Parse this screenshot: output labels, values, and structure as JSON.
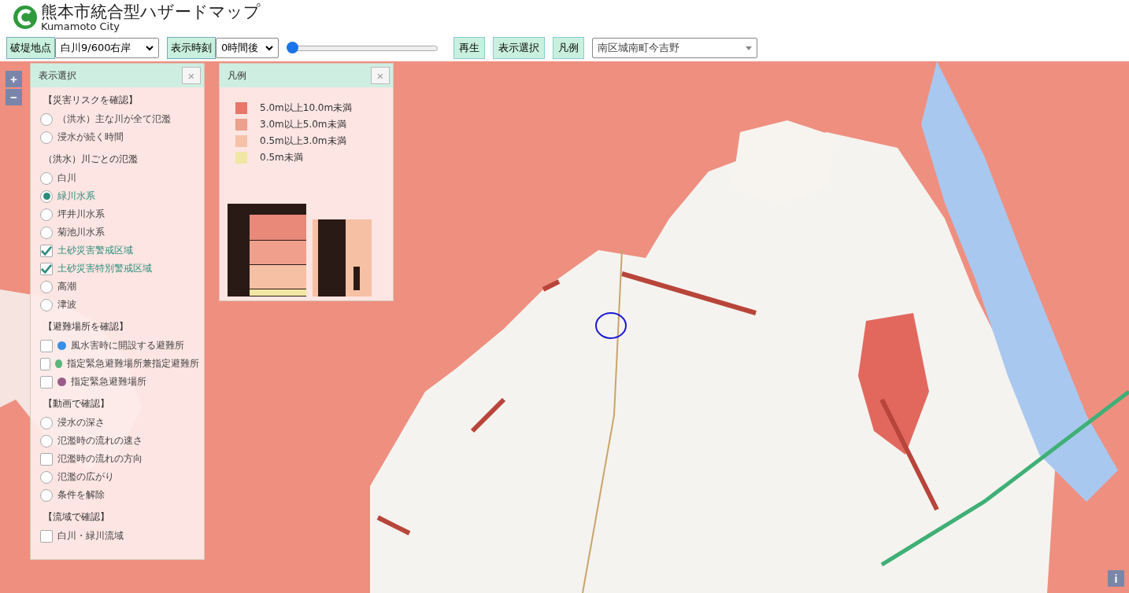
{
  "header": {
    "title": "熊本市統合型ハザードマップ",
    "subtitle": "Kumamoto City"
  },
  "toolbar": {
    "breach_label": "破堤地点",
    "breach_select": "白川9/600右岸",
    "time_label": "表示時刻",
    "time_select": "0時間後",
    "time_slider": {
      "level": 0
    },
    "buttons": [
      "再生",
      "表示選択",
      "凡例"
    ],
    "area_select": "南区城南町今吉野"
  },
  "map": {
    "zoom_in": "+",
    "zoom_out": "−",
    "info": "i"
  },
  "display_panel": {
    "title": "表示選択",
    "close": "×",
    "sections": [
      {
        "heading": "【災害リスクを確認】",
        "items": [
          {
            "kind": "radio",
            "label": "（洪水）主な川が全て氾濫",
            "selected": false
          },
          {
            "kind": "radio",
            "label": "浸水が続く時間",
            "selected": false
          }
        ]
      },
      {
        "heading": "（洪水）川ごとの氾濫",
        "items": [
          {
            "kind": "radio",
            "label": "白川",
            "selected": false
          },
          {
            "kind": "radio",
            "label": "緑川水系",
            "selected": true
          },
          {
            "kind": "radio",
            "label": "坪井川水系",
            "selected": false
          },
          {
            "kind": "radio",
            "label": "菊池川水系",
            "selected": false
          },
          {
            "kind": "checkbox",
            "label": "土砂災害警戒区域",
            "checked": true
          },
          {
            "kind": "checkbox",
            "label": "土砂災害特別警戒区域",
            "checked": true
          },
          {
            "kind": "radio",
            "label": "高潮",
            "selected": false
          },
          {
            "kind": "radio",
            "label": "津波",
            "selected": false
          }
        ]
      },
      {
        "heading": "【避難場所を確認】",
        "items": [
          {
            "kind": "checkbox",
            "label": "風水害時に開設する避難所",
            "checked": false,
            "color": "#3a8ee6"
          },
          {
            "kind": "checkbox",
            "label": "指定緊急避難場所兼指定避難所",
            "checked": false,
            "color": "#5cb57c"
          },
          {
            "kind": "checkbox",
            "label": "指定緊急避難場所",
            "checked": false,
            "color": "#9b5a88"
          }
        ]
      },
      {
        "heading": "【動画で確認】",
        "items": [
          {
            "kind": "radio",
            "label": "浸水の深さ",
            "selected": false
          },
          {
            "kind": "radio",
            "label": "氾濫時の流れの速さ",
            "selected": false
          },
          {
            "kind": "checkbox",
            "label": "氾濫時の流れの方向",
            "checked": false
          },
          {
            "kind": "radio",
            "label": "氾濫の広がり",
            "selected": false
          },
          {
            "kind": "radio",
            "label": "条件を解除",
            "selected": false
          }
        ]
      },
      {
        "heading": "【流域で確認】",
        "items": [
          {
            "kind": "checkbox",
            "label": "白川・緑川流域",
            "checked": false
          }
        ]
      }
    ]
  },
  "legend_panel": {
    "title": "凡例",
    "close": "×",
    "entries": [
      {
        "label": "5.0m以上10.0m未満",
        "color": "#e8776a"
      },
      {
        "label": "3.0m以上5.0m未満",
        "color": "#eda08c"
      },
      {
        "label": "0.5m以上3.0m未満",
        "color": "#f5c2a8"
      },
      {
        "label": "0.5m未満",
        "color": "#f2e6a4"
      }
    ]
  }
}
